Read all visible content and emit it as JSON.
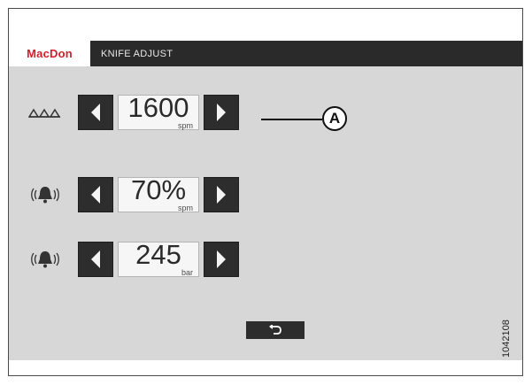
{
  "header": {
    "brand": "MacDon",
    "title": "KNIFE ADJUST"
  },
  "settings": [
    {
      "name": "knife-speed",
      "icon": "knife-speed-icon",
      "value": "1600",
      "unit": "spm"
    },
    {
      "name": "speed-alarm",
      "icon": "alarm-bell-icon",
      "value": "70%",
      "unit": "spm"
    },
    {
      "name": "pressure-alarm",
      "icon": "alarm-bell-icon",
      "value": "245",
      "unit": "bar"
    }
  ],
  "callout": {
    "label": "A"
  },
  "footer": {
    "back_icon": "back-arrow-icon"
  },
  "figure_number": "1042108",
  "colors": {
    "brand_red": "#d21e2b",
    "titlebar": "#2a2a2a",
    "panel": "#d7d7d7",
    "buttons": "#2d2d2d"
  }
}
